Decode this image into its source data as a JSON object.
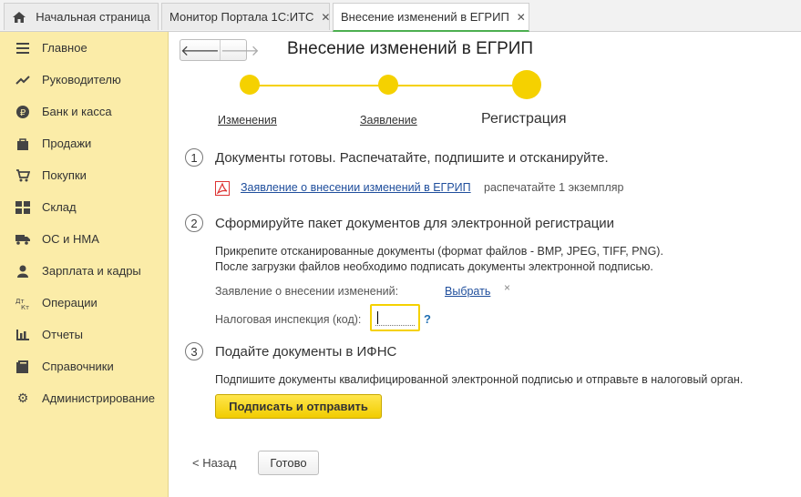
{
  "tabs": [
    {
      "label": "Начальная страница"
    },
    {
      "label": "Монитор Портала 1С:ИТС"
    },
    {
      "label": "Внесение изменений в ЕГРИП"
    }
  ],
  "sidebar": {
    "items": [
      {
        "label": "Главное",
        "icon": "menu-lines-icon"
      },
      {
        "label": "Руководителю",
        "icon": "trend-icon"
      },
      {
        "label": "Банк и касса",
        "icon": "ruble-icon"
      },
      {
        "label": "Продажи",
        "icon": "bag-icon"
      },
      {
        "label": "Покупки",
        "icon": "cart-icon"
      },
      {
        "label": "Склад",
        "icon": "warehouse-icon"
      },
      {
        "label": "ОС и НМА",
        "icon": "truck-icon"
      },
      {
        "label": "Зарплата и кадры",
        "icon": "person-icon"
      },
      {
        "label": "Операции",
        "icon": "dt-kt-icon"
      },
      {
        "label": "Отчеты",
        "icon": "bar-chart-icon"
      },
      {
        "label": "Справочники",
        "icon": "book-icon"
      },
      {
        "label": "Администрирование",
        "icon": "gear-icon"
      }
    ]
  },
  "main": {
    "title": "Внесение изменений в ЕГРИП",
    "steps": [
      {
        "label": "Изменения"
      },
      {
        "label": "Заявление"
      },
      {
        "label": "Регистрация"
      }
    ],
    "section1": {
      "num": "1",
      "title": "Документы готовы. Распечатайте, подпишите и отсканируйте.",
      "link": "Заявление о внесении изменений в ЕГРИП",
      "note": "распечатайте 1 экземпляр"
    },
    "section2": {
      "num": "2",
      "title": "Сформируйте пакет документов для электронной регистрации",
      "line1": "Прикрепите отсканированные документы (формат файлов - BMP, JPEG, TIFF, PNG).",
      "line2": "После загрузки файлов необходимо подписать документы электронной подписью.",
      "statement_label": "Заявление о внесении изменений:",
      "choose_link": "Выбрать",
      "clear_mark": "×",
      "tax_label": "Налоговая инспекция (код):",
      "tax_value": "",
      "help_mark": "?"
    },
    "section3": {
      "num": "3",
      "title": "Подайте документы в ИФНС",
      "text": "Подпишите документы квалифицированной электронной подписью и отправьте в налоговый орган.",
      "button": "Подписать и отправить"
    },
    "footer": {
      "back": "< Назад",
      "done": "Готово"
    }
  },
  "colors": {
    "accent": "#f5d100",
    "sidebar_bg": "#fbeca8",
    "link": "#1f4e9c",
    "active_tab_underline": "#4caf50"
  }
}
